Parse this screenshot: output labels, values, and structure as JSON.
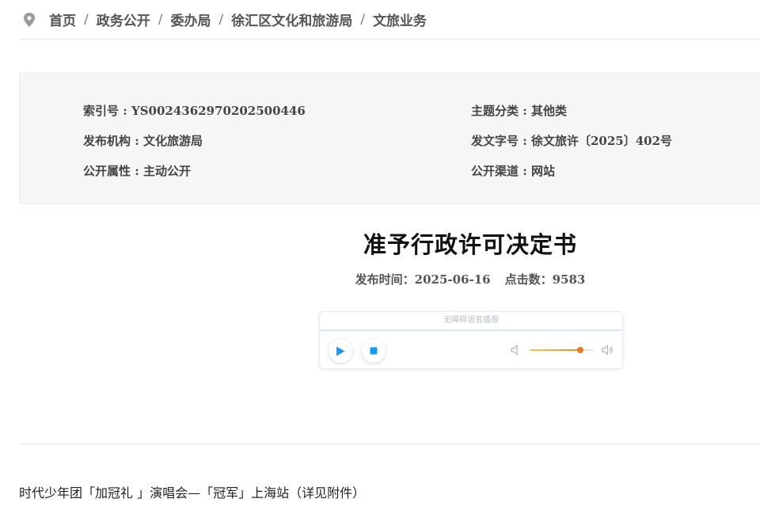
{
  "breadcrumb": {
    "items": [
      "首页",
      "政务公开",
      "委办局",
      "徐汇区文化和旅游局",
      "文旅业务"
    ],
    "separator": "/"
  },
  "info": {
    "index_no": "索引号 : YS0024362970202500446",
    "topic": "主题分类 : 其他类",
    "publisher": "发布机构 : 文化旅游局",
    "doc_no": "发文字号 : 徐文旅许〔2025〕402号",
    "attribute": "公开属性 : 主动公开",
    "channel": "公开渠道 : 网站"
  },
  "document": {
    "title": "准予行政许可决定书",
    "publish_label": "发布时间：",
    "publish_date": "2025-06-16",
    "clicks_label": "点击数：",
    "clicks": "9583"
  },
  "audio_player": {
    "header": "无障碍语音播报",
    "volume_level": 0.8,
    "accent_color": "#1a9bf0",
    "volume_color": "#f07a22"
  },
  "content": {
    "text": "时代少年团「加冠礼 」演唱会—「冠军」上海站（详见附件）"
  },
  "icons": {
    "location": "map-pin-icon",
    "play": "play-icon",
    "stop": "stop-icon",
    "volume_low": "volume-low-icon",
    "volume_high": "volume-high-icon"
  }
}
